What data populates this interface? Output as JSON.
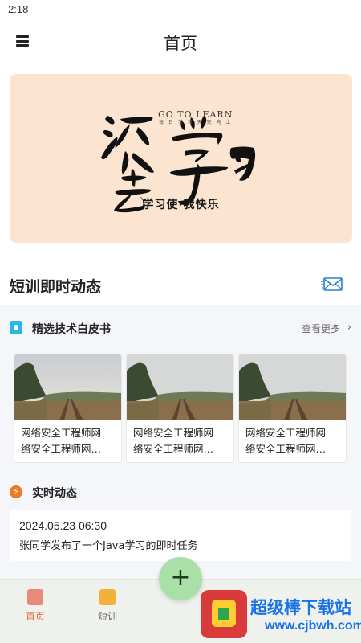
{
  "status_bar": {
    "time": "2:18"
  },
  "app_bar": {
    "title": "首页",
    "menu_icon": "hamburger-menu-icon"
  },
  "banner": {
    "english": "GO TO LEARN",
    "calligraphy": "滚去学习",
    "slogan": "学习使·我快乐",
    "background": "#fbe4d0"
  },
  "section": {
    "title": "短训即时动态",
    "icon": "mail-icon"
  },
  "whitepapers": {
    "title": "精选技术白皮书",
    "more": "查看更多",
    "items": [
      {
        "line1": "网络安全工程师网",
        "line2": "络安全工程师网…"
      },
      {
        "line1": "网络安全工程师网",
        "line2": "络安全工程师网…"
      },
      {
        "line1": "网络安全工程师网",
        "line2": "络安全工程师网…"
      }
    ]
  },
  "realtime": {
    "title": "实时动态",
    "entries": [
      {
        "time": "2024.05.23 06:30",
        "text": "张同学发布了一个Java学习的即时任务"
      }
    ]
  },
  "fab": {
    "label": "+"
  },
  "bottom_nav": {
    "items": [
      {
        "label": "首页",
        "icon": "home-icon",
        "active": true
      },
      {
        "label": "短训",
        "icon": "document-icon",
        "active": false
      }
    ]
  },
  "watermark": {
    "title": "超级棒下载站",
    "url": "www.cjbwh.com"
  },
  "colors": {
    "accent": "#e06a3a",
    "fab": "#a8e0a8",
    "nav_bg": "#eff1ec",
    "link_blue": "#1a73e8"
  }
}
